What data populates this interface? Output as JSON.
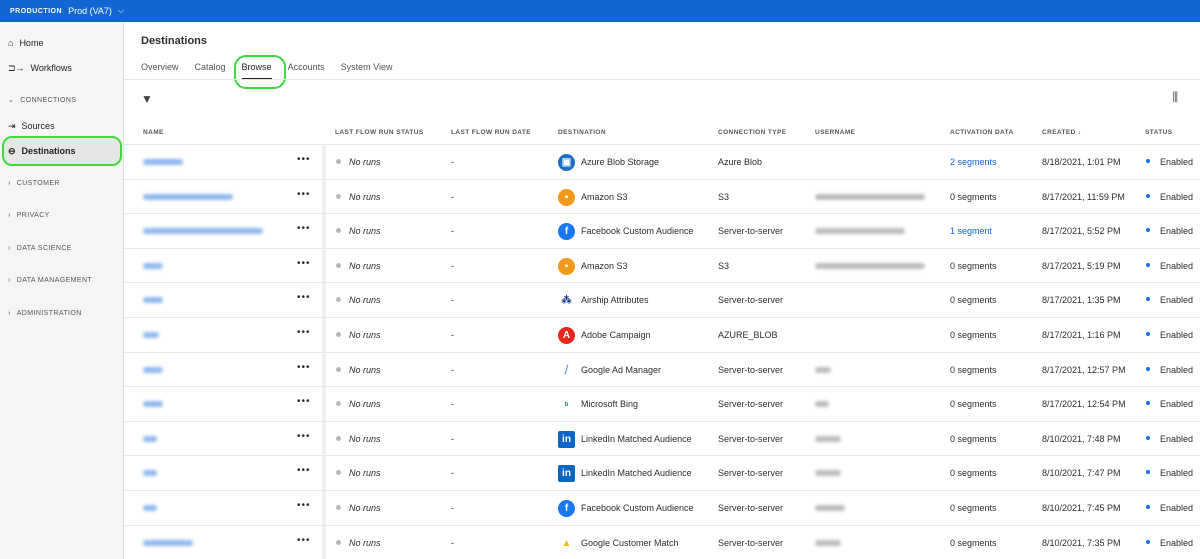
{
  "topbar": {
    "org": "PRODUCTION",
    "sandbox": "Prod (VA7)"
  },
  "sidebar": {
    "items": [
      {
        "label": "Home"
      },
      {
        "label": "Workflows"
      },
      {
        "label": "CONNECTIONS"
      },
      {
        "label": "Sources"
      },
      {
        "label": "Destinations"
      },
      {
        "label": "CUSTOMER"
      },
      {
        "label": "PRIVACY"
      },
      {
        "label": "DATA SCIENCE"
      },
      {
        "label": "DATA MANAGEMENT"
      },
      {
        "label": "ADMINISTRATION"
      }
    ]
  },
  "page": {
    "title": "Destinations",
    "tabs": [
      "Overview",
      "Catalog",
      "Browse",
      "Accounts",
      "System View"
    ]
  },
  "table": {
    "headers": [
      "NAME",
      "LAST FLOW RUN STATUS",
      "LAST FLOW RUN DATE",
      "DESTINATION",
      "CONNECTION TYPE",
      "USERNAME",
      "ACTIVATION DATA",
      "CREATED ↓",
      "STATUS"
    ],
    "rows": [
      {
        "run": "No runs",
        "date": "-",
        "dest": "Azure Blob Storage",
        "icon": "azure",
        "type": "Azure Blob",
        "act": "2 segments",
        "link": true,
        "created": "8/18/2021, 1:01 PM",
        "status": "Enabled"
      },
      {
        "run": "No runs",
        "date": "-",
        "dest": "Amazon S3",
        "icon": "s3",
        "type": "S3",
        "act": "0 segments",
        "created": "8/17/2021, 11:59 PM",
        "status": "Enabled"
      },
      {
        "run": "No runs",
        "date": "-",
        "dest": "Facebook Custom Audience",
        "icon": "fb",
        "type": "Server-to-server",
        "act": "1 segment",
        "link": true,
        "created": "8/17/2021, 5:52 PM",
        "status": "Enabled"
      },
      {
        "run": "No runs",
        "date": "-",
        "dest": "Amazon S3",
        "icon": "s3",
        "type": "S3",
        "act": "0 segments",
        "created": "8/17/2021, 5:19 PM",
        "status": "Enabled"
      },
      {
        "run": "No runs",
        "date": "-",
        "dest": "Airship Attributes",
        "icon": "airship",
        "type": "Server-to-server",
        "act": "0 segments",
        "created": "8/17/2021, 1:35 PM",
        "status": "Enabled"
      },
      {
        "run": "No runs",
        "date": "-",
        "dest": "Adobe Campaign",
        "icon": "adobe",
        "type": "AZURE_BLOB",
        "act": "0 segments",
        "created": "8/17/2021, 1:16 PM",
        "status": "Enabled"
      },
      {
        "run": "No runs",
        "date": "-",
        "dest": "Google Ad Manager",
        "icon": "gam",
        "type": "Server-to-server",
        "act": "0 segments",
        "created": "8/17/2021, 12:57 PM",
        "status": "Enabled"
      },
      {
        "run": "No runs",
        "date": "-",
        "dest": "Microsoft Bing",
        "icon": "bing",
        "type": "Server-to-server",
        "act": "0 segments",
        "created": "8/17/2021, 12:54 PM",
        "status": "Enabled"
      },
      {
        "run": "No runs",
        "date": "-",
        "dest": "LinkedIn Matched Audience",
        "icon": "li",
        "type": "Server-to-server",
        "act": "0 segments",
        "created": "8/10/2021, 7:48 PM",
        "status": "Enabled"
      },
      {
        "run": "No runs",
        "date": "-",
        "dest": "LinkedIn Matched Audience",
        "icon": "li",
        "type": "Server-to-server",
        "act": "0 segments",
        "created": "8/10/2021, 7:47 PM",
        "status": "Enabled"
      },
      {
        "run": "No runs",
        "date": "-",
        "dest": "Facebook Custom Audience",
        "icon": "fb",
        "type": "Server-to-server",
        "act": "0 segments",
        "created": "8/10/2021, 7:45 PM",
        "status": "Enabled"
      },
      {
        "run": "No runs",
        "date": "-",
        "dest": "Google Customer Match",
        "icon": "gcm",
        "type": "Server-to-server",
        "act": "0 segments",
        "created": "8/10/2021, 7:35 PM",
        "status": "Enabled"
      }
    ]
  }
}
